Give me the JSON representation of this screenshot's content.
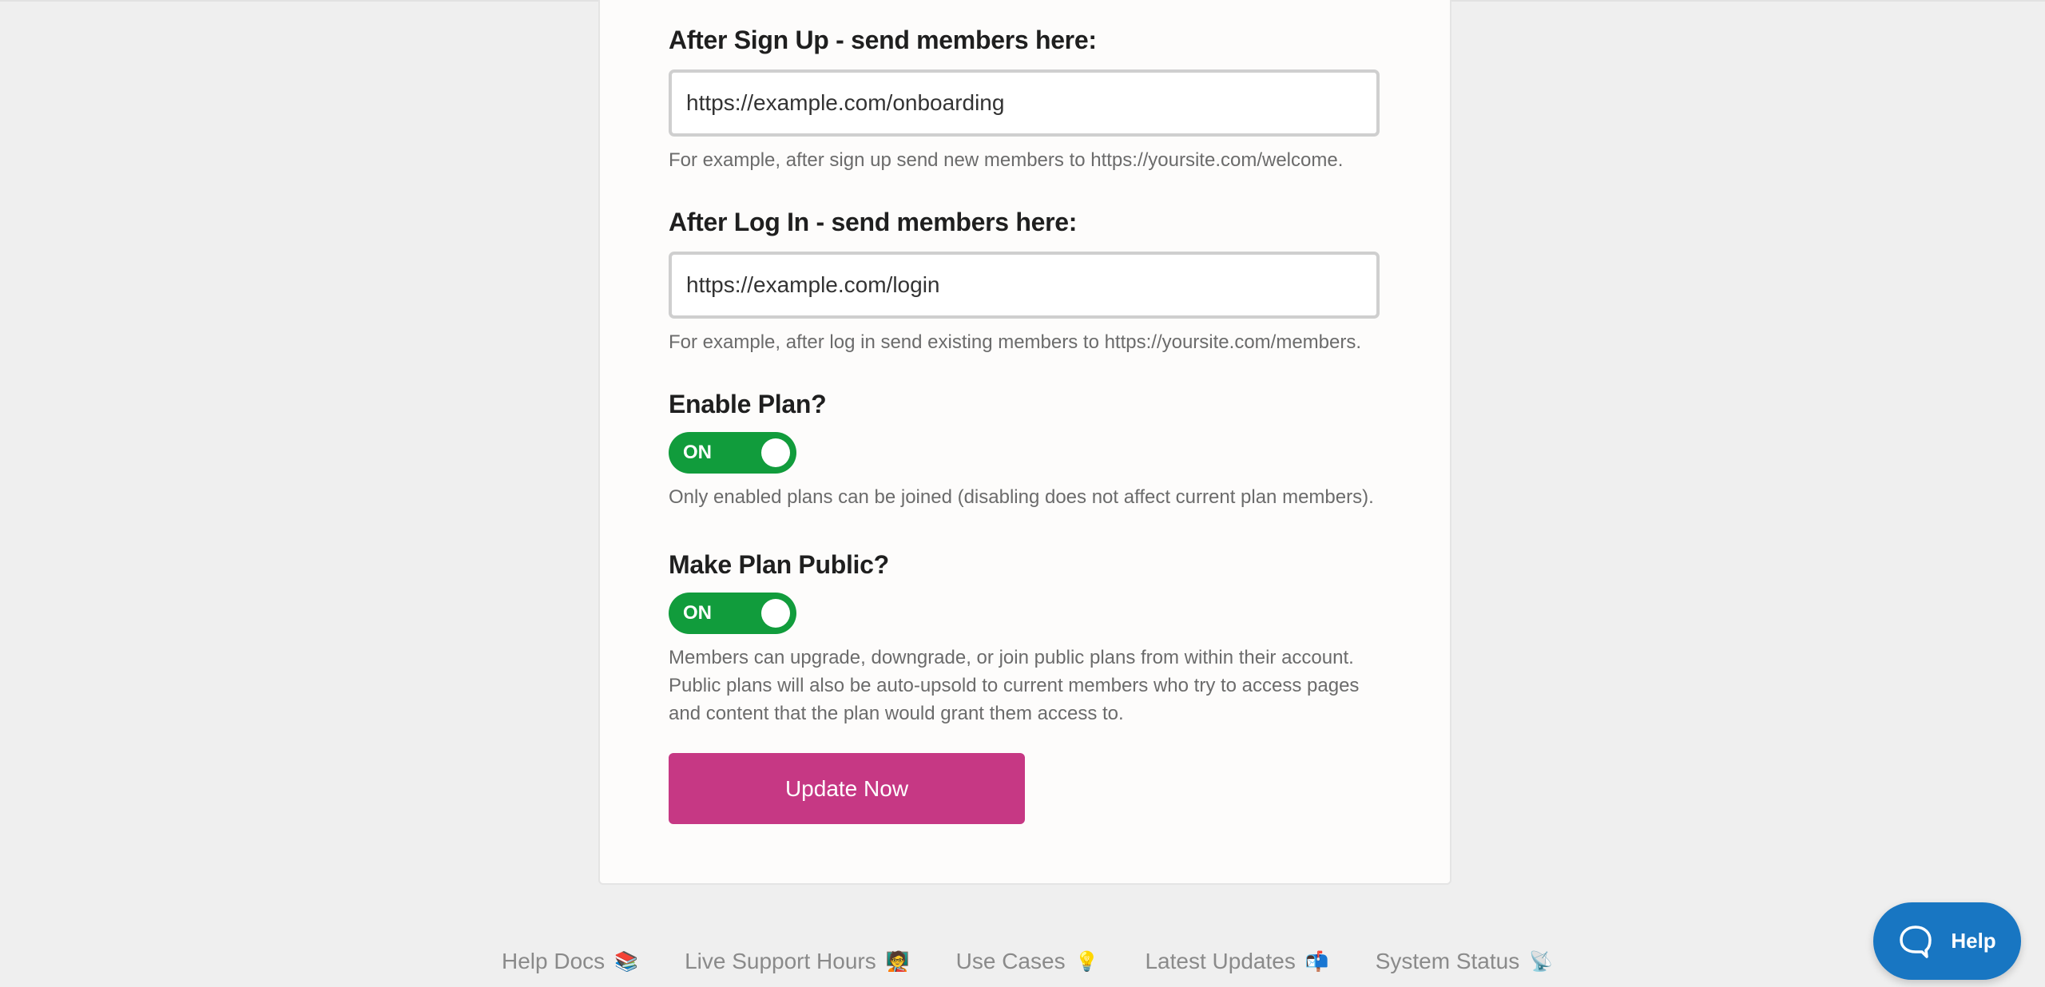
{
  "form": {
    "after_signup": {
      "label": "After Sign Up - send members here:",
      "value": "https://example.com/onboarding",
      "hint": "For example, after sign up send new members to https://yoursite.com/welcome."
    },
    "after_login": {
      "label": "After Log In - send members here:",
      "value": "https://example.com/login",
      "hint": "For example, after log in send existing members to https://yoursite.com/members."
    },
    "enable_plan": {
      "label": "Enable Plan?",
      "state": "ON",
      "hint": "Only enabled plans can be joined (disabling does not affect current plan members)."
    },
    "make_public": {
      "label": "Make Plan Public?",
      "state": "ON",
      "hint": "Members can upgrade, downgrade, or join public plans from within their account. Public plans will also be auto-upsold to current members who try to access pages and content that the plan would grant them access to."
    },
    "submit_label": "Update Now"
  },
  "footer": {
    "links": [
      {
        "label": "Help Docs",
        "icon": "📚",
        "icon_name": "books-icon"
      },
      {
        "label": "Live Support Hours",
        "icon": "🧑‍🏫",
        "icon_name": "teacher-icon"
      },
      {
        "label": "Use Cases",
        "icon": "💡",
        "icon_name": "lightbulb-icon"
      },
      {
        "label": "Latest Updates",
        "icon": "📬",
        "icon_name": "mailbox-icon"
      },
      {
        "label": "System Status",
        "icon": "📡",
        "icon_name": "satellite-icon"
      }
    ]
  },
  "help_widget": {
    "label": "Help",
    "icon": "chat-bubble-icon"
  },
  "colors": {
    "toggle_on": "#119c3c",
    "primary_button": "#c63884",
    "help_button": "#1876c2"
  }
}
